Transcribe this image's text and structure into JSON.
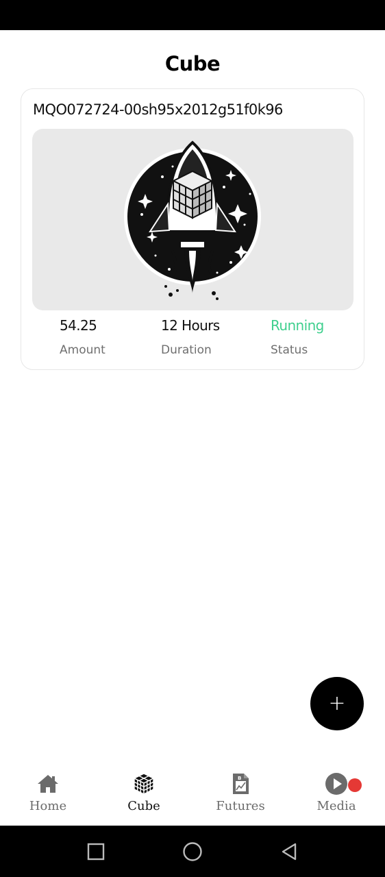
{
  "header": {
    "title": "Cube"
  },
  "card": {
    "id": "MQO072724-00sh95x2012g51f0k96",
    "image": "rocket-cube-logo",
    "stats": {
      "amount": {
        "value": "54.25",
        "label": "Amount"
      },
      "duration": {
        "value": "12 Hours",
        "label": "Duration"
      },
      "status": {
        "value": "Running",
        "label": "Status",
        "color": "#3fcf8e"
      }
    }
  },
  "fab": {
    "icon": "plus-icon"
  },
  "bottom_nav": {
    "items": [
      {
        "label": "Home",
        "icon": "home-icon",
        "active": false
      },
      {
        "label": "Cube",
        "icon": "cube-icon",
        "active": true
      },
      {
        "label": "Futures",
        "icon": "futures-document-icon",
        "active": false
      },
      {
        "label": "Media",
        "icon": "play-icon",
        "active": false,
        "has_badge": true
      }
    ]
  },
  "colors": {
    "accent": "#000000",
    "status_running": "#3fcf8e",
    "badge": "#e53935"
  }
}
